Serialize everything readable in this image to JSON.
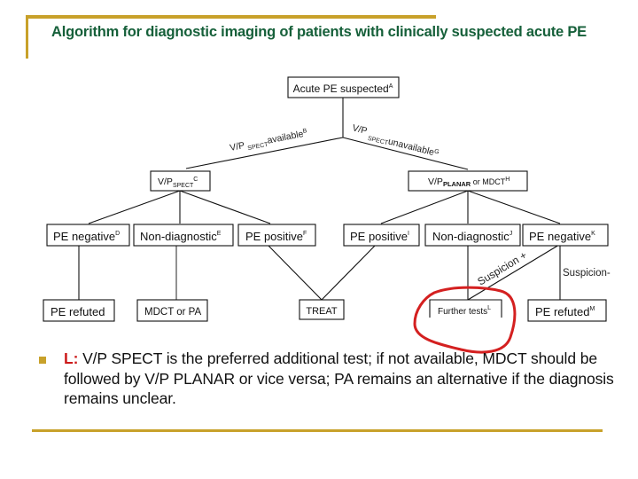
{
  "title": "Algorithm for diagnostic imaging of patients with clinically suspected acute PE",
  "diagram": {
    "nodes": {
      "root": {
        "text": "Acute PE suspected",
        "sup": "A"
      },
      "spect": {
        "text": "V/P",
        "sub": "SPECT",
        "sup": "C"
      },
      "planar": {
        "text": "V/P",
        "sub": "PLANAR",
        "tail": " or MDCT",
        "sup": "H"
      },
      "left_negative": {
        "text": "PE negative",
        "sup": "D"
      },
      "left_nondiag": {
        "text": "Non-diagnostic",
        "sup": "E"
      },
      "left_positive": {
        "text": "PE positive",
        "sup": "F"
      },
      "right_positive": {
        "text": "PE positive",
        "sup": "I"
      },
      "right_nondiag": {
        "text": "Non-diagnostic",
        "sup": "J"
      },
      "right_negative": {
        "text": "PE negative",
        "sup": "K"
      },
      "refuted_left": {
        "text": "PE refuted"
      },
      "mdct_pa": {
        "text": "MDCT or PA"
      },
      "treat": {
        "text": "TREAT"
      },
      "further_tests": {
        "text": "Further tests",
        "sup": "L"
      },
      "refuted_right": {
        "text": "PE refuted",
        "sup": "M"
      }
    },
    "edges": {
      "spect_available": {
        "pre": "V/P ",
        "sub": "SPECT",
        "text": "available",
        "sup": "B"
      },
      "spect_unavailable": {
        "pre": "V/P ",
        "sub": "SPECT",
        "text": "unavailable",
        "sup": "G"
      },
      "suspicion_plus": "Suspicion +",
      "suspicion_minus": "Suspicion-"
    },
    "annotation_color": "#d42020"
  },
  "note": {
    "key": "L:",
    "text": " V/P SPECT is the preferred additional test; if not available, MDCT should be followed by V/P PLANAR or vice versa; PA remains an alternative if the diagnosis remains unclear."
  },
  "colors": {
    "title": "#16603a",
    "rule": "#c8a12a",
    "note_key": "#cc1a1a"
  }
}
